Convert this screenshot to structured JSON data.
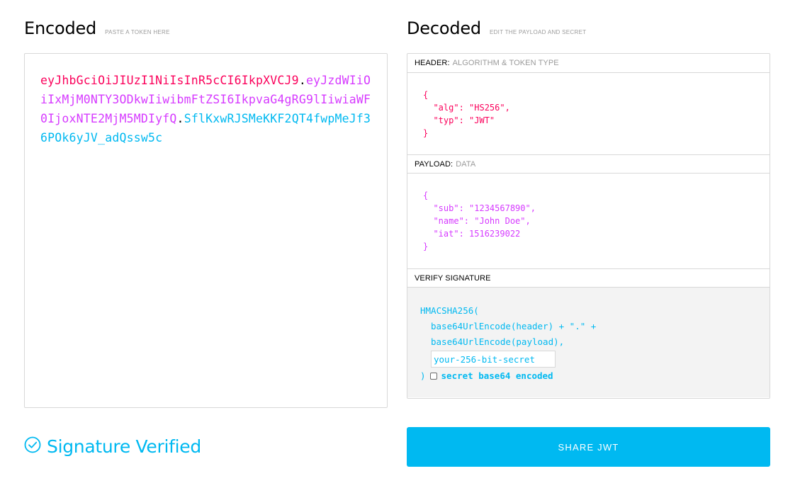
{
  "encoded": {
    "title": "Encoded",
    "subtitle": "PASTE A TOKEN HERE",
    "token": {
      "header": "eyJhbGciOiJIUzI1NiIsInR5cCI6IkpXVCJ9",
      "dot1": ".",
      "payload": "eyJzdWIiOiIxMjM0NTY3ODkwIiwibmFtZSI6IkpvaG4gRG9lIiwiaWF0IjoxNTE2MjM5MDIyfQ",
      "dot2": ".",
      "signature": "SflKxwRJSMeKKF2QT4fwpMeJf36POk6yJV_adQssw5c"
    }
  },
  "decoded": {
    "title": "Decoded",
    "subtitle": "EDIT THE PAYLOAD AND SECRET",
    "header_section": {
      "label": "HEADER:",
      "sublabel": "ALGORITHM & TOKEN TYPE",
      "lines": [
        "{",
        "  \"alg\": \"HS256\",",
        "  \"typ\": \"JWT\"",
        "}"
      ]
    },
    "payload_section": {
      "label": "PAYLOAD:",
      "sublabel": "DATA",
      "lines": [
        "{",
        "  \"sub\": \"1234567890\",",
        "  \"name\": \"John Doe\",",
        "  \"iat\": 1516239022",
        "}"
      ]
    },
    "verify_section": {
      "label": "VERIFY SIGNATURE",
      "fn_open": "HMACSHA256(",
      "line1": "base64UrlEncode(header) + \".\" +",
      "line2": "base64UrlEncode(payload),",
      "secret_placeholder": "your-256-bit-secret",
      "fn_close": ")",
      "checkbox_label": "secret base64 encoded"
    }
  },
  "status": {
    "text": "Signature Verified",
    "icon": "check-circle-icon"
  },
  "share_button": {
    "label": "SHARE JWT"
  },
  "colors": {
    "header": "#fb015b",
    "payload": "#d63aff",
    "signature": "#00b9f1"
  }
}
